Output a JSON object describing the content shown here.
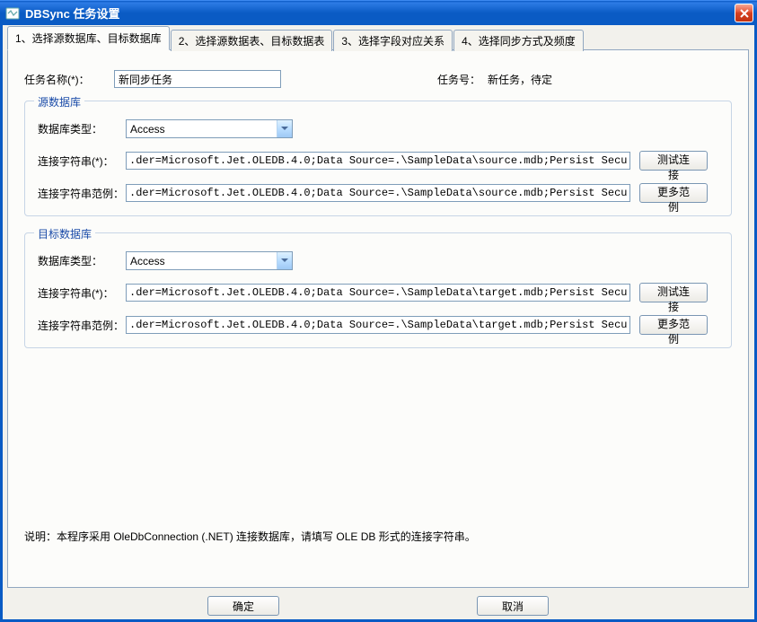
{
  "window": {
    "title": "DBSync 任务设置"
  },
  "tabs": [
    {
      "label": "1、选择源数据库、目标数据库",
      "active": true
    },
    {
      "label": "2、选择源数据表、目标数据表",
      "active": false
    },
    {
      "label": "3、选择字段对应关系",
      "active": false
    },
    {
      "label": "4、选择同步方式及频度",
      "active": false
    }
  ],
  "task": {
    "name_label": "任务名称(*)：",
    "name_value": "新同步任务",
    "id_label": "任务号：",
    "id_value": "新任务，待定"
  },
  "source": {
    "legend": "源数据库",
    "dbtype_label": "数据库类型：",
    "dbtype_value": "Access",
    "conn_label": "连接字符串(*)：",
    "conn_value": ".der=Microsoft.Jet.OLEDB.4.0;Data Source=.\\SampleData\\source.mdb;Persist Security Info=False;",
    "example_label": "连接字符串范例：",
    "example_value": ".der=Microsoft.Jet.OLEDB.4.0;Data Source=.\\SampleData\\source.mdb;Persist Security Info=False;",
    "test_btn": "测试连接",
    "more_btn": "更多范例"
  },
  "target": {
    "legend": "目标数据库",
    "dbtype_label": "数据库类型：",
    "dbtype_value": "Access",
    "conn_label": "连接字符串(*)：",
    "conn_value": ".der=Microsoft.Jet.OLEDB.4.0;Data Source=.\\SampleData\\target.mdb;Persist Security Info=False;",
    "example_label": "连接字符串范例：",
    "example_value": ".der=Microsoft.Jet.OLEDB.4.0;Data Source=.\\SampleData\\target.mdb;Persist Security Info=False;",
    "test_btn": "测试连接",
    "more_btn": "更多范例"
  },
  "note": "说明：本程序采用 OleDbConnection (.NET) 连接数据库，请填写 OLE DB 形式的连接字符串。",
  "footer": {
    "ok": "确定",
    "cancel": "取消"
  }
}
